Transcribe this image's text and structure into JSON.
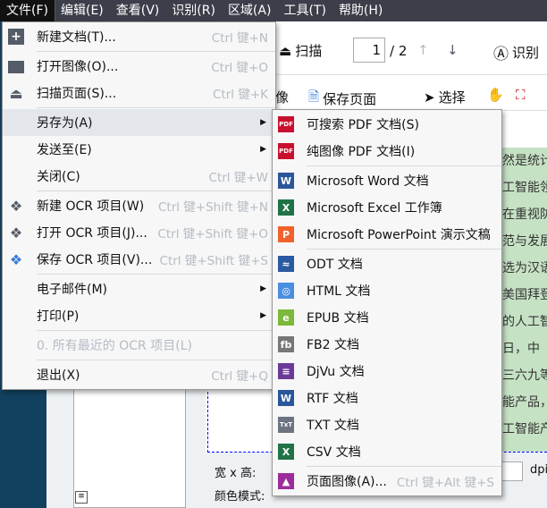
{
  "menubar": [
    "文件(F)",
    "编辑(E)",
    "查看(V)",
    "识别(R)",
    "区域(A)",
    "工具(T)",
    "帮助(H)"
  ],
  "toolbar": {
    "scan": "扫描",
    "page_current": "1",
    "page_total": "/ 2",
    "recognize": "识别",
    "image_partial": "像",
    "save_page": "保存页面",
    "select": "选择"
  },
  "document_text": [
    "然是统计",
    "工智能领",
    "在重视防",
    "范与发展",
    "选为汉语",
    "美国拜登",
    "的人工智",
    "日，中",
    "三六九等",
    "能产品，",
    "工智能产"
  ],
  "properties": {
    "size_label": "宽 x 高:",
    "color_label": "颜色模式:",
    "dpi": "dpi"
  },
  "file_menu": {
    "new_doc": {
      "label": "新建文档(T)...",
      "shortcut": "Ctrl 键+N"
    },
    "open_image": {
      "label": "打开图像(O)...",
      "shortcut": "Ctrl 键+O"
    },
    "scan_page": {
      "label": "扫描页面(S)...",
      "shortcut": "Ctrl 键+K"
    },
    "save_as": {
      "label": "另存为(A)"
    },
    "send_to": {
      "label": "发送至(E)"
    },
    "close": {
      "label": "关闭(C)",
      "shortcut": "Ctrl 键+W"
    },
    "new_ocr": {
      "label": "新建 OCR 项目(W)",
      "shortcut": "Ctrl 键+Shift 键+N"
    },
    "open_ocr": {
      "label": "打开 OCR 项目(J)...",
      "shortcut": "Ctrl 键+Shift 键+O"
    },
    "save_ocr": {
      "label": "保存 OCR 项目(V)...",
      "shortcut": "Ctrl 键+Shift 键+S"
    },
    "email": {
      "label": "电子邮件(M)"
    },
    "print": {
      "label": "打印(P)"
    },
    "recent": {
      "label": "0. 所有最近的 OCR 项目(L)"
    },
    "exit": {
      "label": "退出(X)",
      "shortcut": "Ctrl 键+Q"
    }
  },
  "save_as_menu": [
    {
      "label": "可搜索 PDF 文档(S)",
      "icon": "pdf-icon",
      "color": "#c8102e",
      "glyph": "PDF"
    },
    {
      "label": "纯图像 PDF 文档(I)",
      "icon": "pdf-icon",
      "color": "#c8102e",
      "glyph": "PDF"
    },
    {
      "label": "Microsoft Word 文档",
      "icon": "word-icon",
      "color": "#2b579a",
      "glyph": "W"
    },
    {
      "label": "Microsoft Excel 工作簿",
      "icon": "excel-icon",
      "color": "#217346",
      "glyph": "X"
    },
    {
      "label": "Microsoft PowerPoint 演示文稿",
      "icon": "powerpoint-icon",
      "color": "#f0622d",
      "glyph": "P"
    },
    {
      "label": "ODT 文档",
      "icon": "odt-icon",
      "color": "#2a5aa0",
      "glyph": "≈"
    },
    {
      "label": "HTML 文档",
      "icon": "html-icon",
      "color": "#4a8ee0",
      "glyph": "◎"
    },
    {
      "label": "EPUB 文档",
      "icon": "epub-icon",
      "color": "#7cb83a",
      "glyph": "e"
    },
    {
      "label": "FB2 文档",
      "icon": "fb2-icon",
      "color": "#777777",
      "glyph": "fb"
    },
    {
      "label": "DjVu 文档",
      "icon": "djvu-icon",
      "color": "#6a3a9a",
      "glyph": "≡"
    },
    {
      "label": "RTF 文档",
      "icon": "rtf-icon",
      "color": "#2b579a",
      "glyph": "W"
    },
    {
      "label": "TXT 文档",
      "icon": "txt-icon",
      "color": "#6b7480",
      "glyph": "TxT"
    },
    {
      "label": "CSV 文档",
      "icon": "csv-icon",
      "color": "#217346",
      "glyph": "X"
    },
    {
      "label": "页面图像(A)...",
      "shortcut": "Ctrl 键+Alt 键+S",
      "icon": "image-icon",
      "color": "#9b2d9b",
      "glyph": "▲"
    }
  ]
}
